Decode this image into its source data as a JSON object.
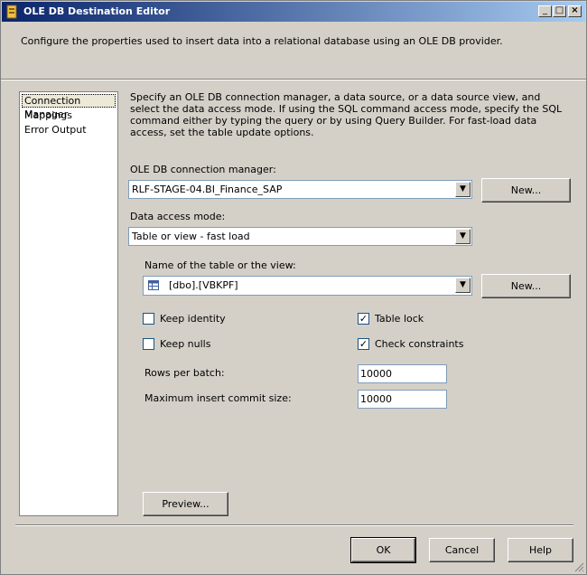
{
  "window": {
    "title": "OLE DB Destination Editor",
    "description": "Configure the properties used to insert data into a relational database using an OLE DB provider."
  },
  "nav": {
    "items": [
      "Connection Manager",
      "Mappings",
      "Error Output"
    ],
    "selected": "Connection Manager"
  },
  "main": {
    "description": "Specify an OLE DB connection manager, a data source, or a data source view, and select the data access mode. If using the SQL command access mode, specify the SQL command either by typing the query or by using Query Builder. For fast-load data access, set the table update options.",
    "connection_manager": {
      "label": "OLE DB connection manager:",
      "value": "RLF-STAGE-04.BI_Finance_SAP",
      "new_label": "New..."
    },
    "access_mode": {
      "label": "Data access mode:",
      "value": "Table or view - fast load"
    },
    "table": {
      "label": "Name of the table or the view:",
      "value": "[dbo].[VBKPF]",
      "new_label": "New..."
    },
    "options": {
      "keep_identity": {
        "label": "Keep identity",
        "checked": false
      },
      "keep_nulls": {
        "label": "Keep nulls",
        "checked": false
      },
      "table_lock": {
        "label": "Table lock",
        "checked": true
      },
      "check_constraints": {
        "label": "Check constraints",
        "checked": true
      }
    },
    "rows_per_batch": {
      "label": "Rows per batch:",
      "value": "10000"
    },
    "max_commit": {
      "label": "Maximum insert commit size:",
      "value": "10000"
    },
    "preview_label": "Preview..."
  },
  "footer": {
    "ok_label": "OK",
    "cancel_label": "Cancel",
    "help_label": "Help"
  }
}
